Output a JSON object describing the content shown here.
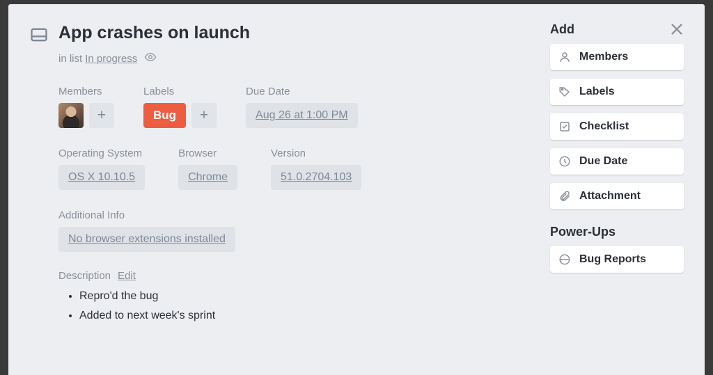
{
  "header": {
    "title": "App crashes on launch",
    "in_list_prefix": "in list",
    "list_name": "In progress"
  },
  "members": {
    "title": "Members"
  },
  "labels": {
    "title": "Labels",
    "items": [
      "Bug"
    ]
  },
  "due_date": {
    "title": "Due Date",
    "value": "Aug 26 at 1:00 PM"
  },
  "fields": {
    "os": {
      "title": "Operating System",
      "value": "OS X 10.10.5"
    },
    "browser": {
      "title": "Browser",
      "value": "Chrome"
    },
    "version": {
      "title": "Version",
      "value": "51.0.2704.103"
    }
  },
  "additional_info": {
    "title": "Additional Info",
    "value": "No browser extensions installed"
  },
  "description": {
    "title": "Description",
    "edit_label": "Edit",
    "items": [
      "Repro'd the bug",
      "Added to next week's sprint"
    ]
  },
  "sidebar": {
    "add_title": "Add",
    "add_buttons": {
      "members": "Members",
      "labels": "Labels",
      "checklist": "Checklist",
      "due_date": "Due Date",
      "attachment": "Attachment"
    },
    "powerups_title": "Power-Ups",
    "powerups_buttons": {
      "bug_reports": "Bug Reports"
    }
  }
}
